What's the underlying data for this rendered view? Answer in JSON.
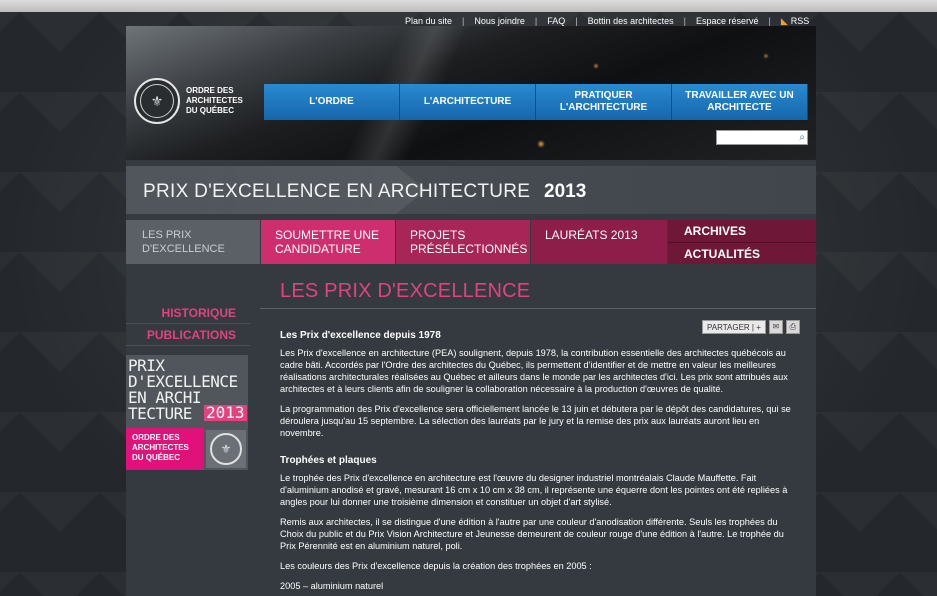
{
  "utility_nav": {
    "items": [
      "Plan du site",
      "Nous joindre",
      "FAQ",
      "Bottin des architectes",
      "Espace réservé"
    ],
    "rss_label": "RSS",
    "separator": "|"
  },
  "logo": {
    "text": "ORDRE DES\nARCHITECTES\nDU QUÉBEC"
  },
  "main_nav": {
    "items": [
      {
        "label": "L'ORDRE"
      },
      {
        "label": "L'ARCHITECTURE"
      },
      {
        "label": "PRATIQUER\nL'ARCHITECTURE"
      },
      {
        "label": "TRAVAILLER AVEC UN\nARCHITECTE"
      }
    ]
  },
  "search": {
    "placeholder": ""
  },
  "banner": {
    "title": "PRIX D'EXCELLENCE EN ARCHITECTURE",
    "year": "2013"
  },
  "sub_nav": {
    "current": "LES PRIX\nD'EXCELLENCE",
    "tabs": [
      {
        "label": "SOUMETTRE UNE\nCANDIDATURE"
      },
      {
        "label": "PROJETS\nPRÉSÉLECTIONNÉS"
      },
      {
        "label": "LAURÉATS 2013"
      }
    ],
    "stacked": [
      "ARCHIVES",
      "ACTUALITÉS"
    ]
  },
  "sidebar": {
    "links": [
      "HISTORIQUE",
      "PUBLICATIONS"
    ],
    "promo": {
      "title": "PRIX\nD'EXCELLENCE\nEN ARCHI\nTECTURE",
      "year": "2013",
      "org": "ORDRE DES\nARCHITECTES\nDU QUÉBEC"
    }
  },
  "content": {
    "page_title": "LES PRIX D'EXCELLENCE",
    "share_label": "PARTAGER | +",
    "sections": [
      {
        "heading": "Les Prix d'excellence depuis 1978",
        "paragraphs": [
          "Les Prix d'excellence en architecture (PEA) soulignent, depuis 1978, la contribution essentielle des architectes québécois au cadre bâti. Accordés par l'Ordre des architectes du Québec, ils permettent d'identifier et de mettre en valeur les meilleures réalisations architecturales réalisées au Québec et ailleurs dans le monde par les architectes d'ici. Les prix sont attribués aux architectes et à leurs clients afin de souligner la collaboration nécessaire à la production d'œuvres de qualité.",
          "La programmation des Prix d'excellence sera officiellement lancée le 13 juin et débutera par le dépôt des candidatures, qui se déroulera jusqu'au 15 septembre. La sélection des lauréats par le jury et la remise des prix aux lauréats auront lieu en novembre."
        ]
      },
      {
        "heading": "Trophées et plaques",
        "paragraphs": [
          "Le trophée des Prix d'excellence en architecture est l'œuvre du designer industriel montréalais Claude Mauffette. Fait d'aluminium anodisé et gravé, mesurant 16 cm x 10 cm x 38 cm, il représente une équerre dont les pointes ont été repliées à angles pour lui donner une troisième dimension et constituer un objet d'art stylisé.",
          "Remis aux architectes, il se distingue d'une édition à l'autre par une couleur d'anodisation différente. Seuls les trophées du Choix du public et du Prix Vision Architecture et Jeunesse demeurent de couleur rouge d'une édition à l'autre. Le trophée du Prix Pérennité est en aluminium naturel, poli.",
          "Les couleurs des Prix d'excellence depuis la création des trophées en 2005 :",
          "2005 – aluminium naturel"
        ]
      }
    ]
  },
  "colors": {
    "accent_pink": "#e0437e",
    "nav_blue": "#1f7ac2",
    "tab_magenta": "#cd2f6e",
    "tab_archives": "#6f1737"
  }
}
